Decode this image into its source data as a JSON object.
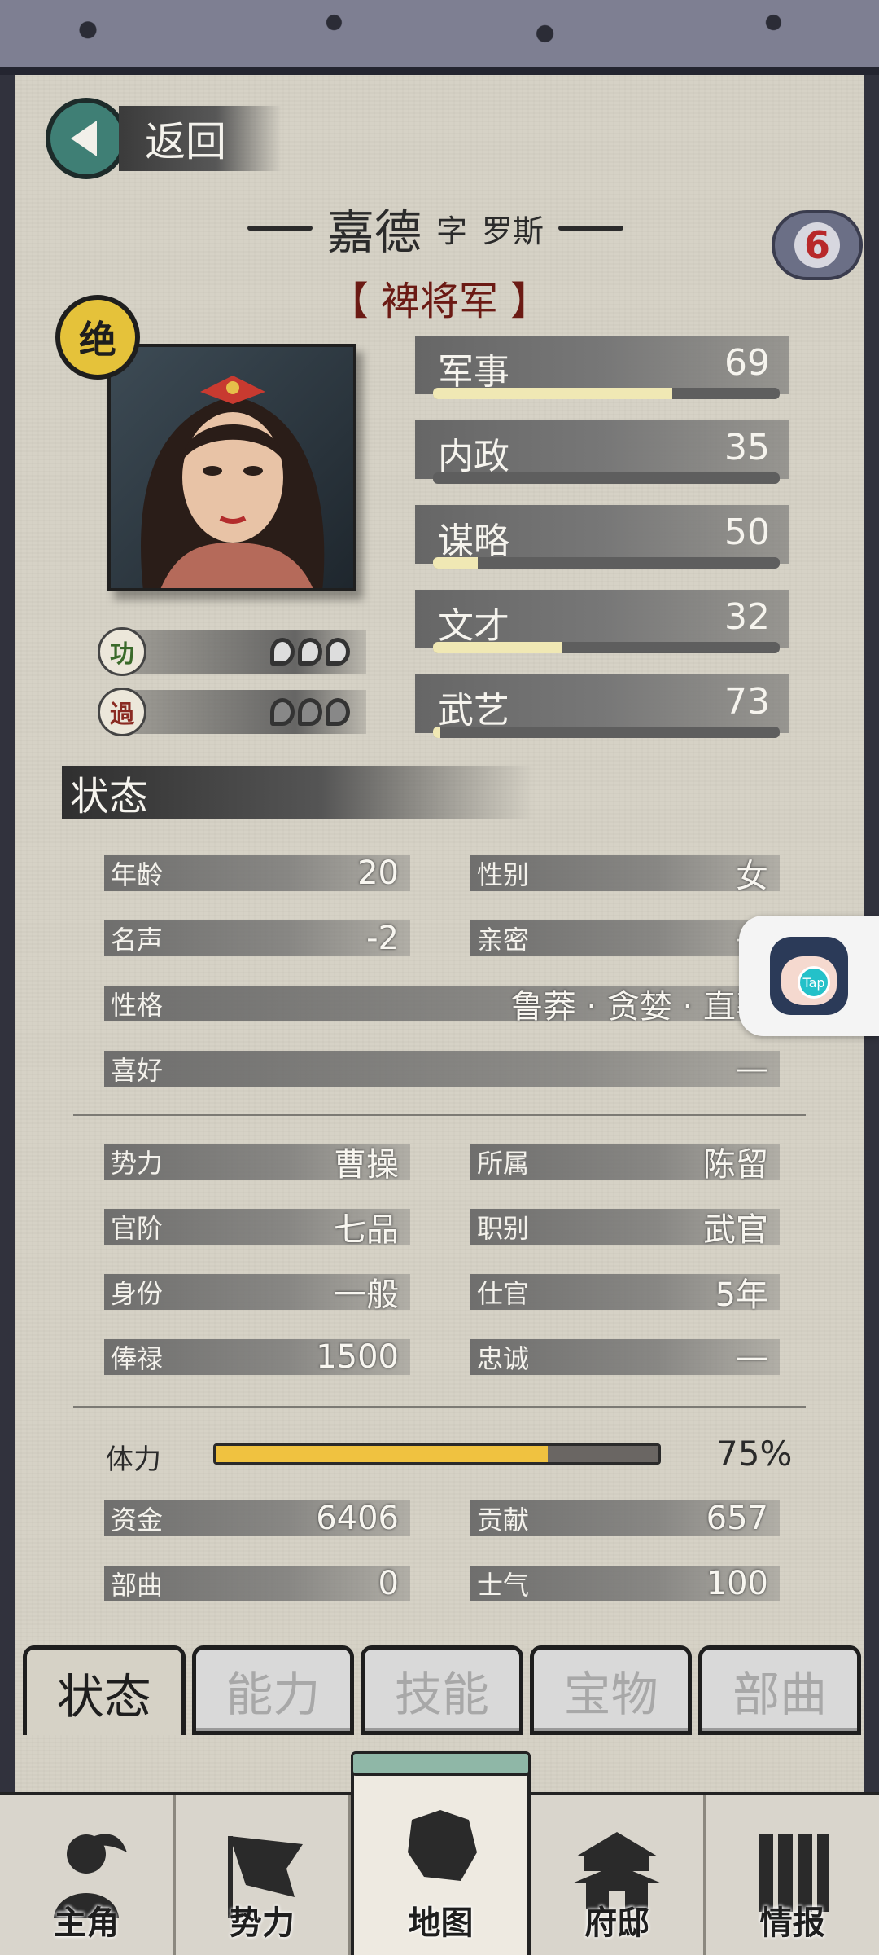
{
  "back": {
    "label": "返回"
  },
  "header": {
    "name": "嘉德",
    "zi_prefix": "字",
    "zi": "罗斯",
    "title": "【 裨将军 】",
    "badge_number": "6",
    "grade": "绝"
  },
  "merit": {
    "label": "功",
    "count": 3
  },
  "fault": {
    "label": "過",
    "count": 3
  },
  "attributes": [
    {
      "label": "军事",
      "value": "69",
      "fill": 0.69
    },
    {
      "label": "内政",
      "value": "35",
      "fill": 0.0
    },
    {
      "label": "谋略",
      "value": "50",
      "fill": 0.13
    },
    {
      "label": "文才",
      "value": "32",
      "fill": 0.37
    },
    {
      "label": "武艺",
      "value": "73",
      "fill": 0.02
    }
  ],
  "status_section": {
    "title": "状态"
  },
  "info": {
    "age_label": "年龄",
    "age": "20",
    "gender_label": "性别",
    "gender": "女",
    "fame_label": "名声",
    "fame": "-2",
    "intimacy_label": "亲密",
    "intimacy": "—",
    "personality_label": "性格",
    "personality": "鲁莽 · 贪婪 · 直率",
    "hobby_label": "喜好",
    "hobby": "—",
    "faction_label": "势力",
    "faction": "曹操",
    "belong_label": "所属",
    "belong": "陈留",
    "rank_label": "官阶",
    "rank": "七品",
    "job_label": "职别",
    "job": "武官",
    "identity_label": "身份",
    "identity": "一般",
    "service_label": "仕官",
    "service": "5年",
    "salary_label": "俸禄",
    "salary": "1500",
    "loyalty_label": "忠诚",
    "loyalty": "—",
    "stamina_label": "体力",
    "stamina": "75%",
    "stamina_fill": 0.75,
    "funds_label": "资金",
    "funds": "6406",
    "contribution_label": "贡献",
    "contribution": "657",
    "troops_label": "部曲",
    "troops": "0",
    "morale_label": "士气",
    "morale": "100"
  },
  "tabs": [
    "状态",
    "能力",
    "技能",
    "宝物",
    "部曲"
  ],
  "nav": [
    "主角",
    "势力",
    "地图",
    "府邸",
    "情报"
  ],
  "floating": {
    "tap_label": "Tap"
  },
  "colors": {
    "accent_gold": "#e5c23a",
    "title_red": "#6b1a14",
    "stamina": "#f0c240",
    "back_teal": "#3f7f75"
  }
}
